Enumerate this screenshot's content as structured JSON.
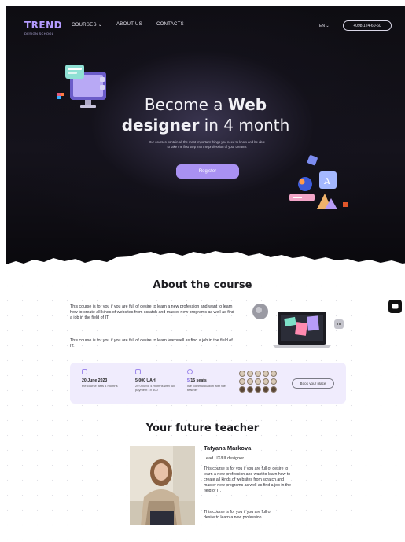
{
  "nav": {
    "logo": "TREND",
    "logo_sub": "DESIGN SCHOOL",
    "courses": "COURSES",
    "about": "ABOUT US",
    "contacts": "CONTACTS",
    "lang": "EN",
    "phone": "+098 124-60-60"
  },
  "hero": {
    "title_1_pre": "Become a ",
    "title_1_bold": "Web",
    "title_2_bold": "designer",
    "title_2_post": " in 4 month",
    "description": "Our courses contain all the most important things you need to know and be able to take the first step into the profession of your dreams",
    "register_label": "Register"
  },
  "about": {
    "title": "About the course",
    "paragraph_1": "This course is for you if you are full of desire to learn a new profession and want to learn how to create all kinds of websites from scratch and master new programs as well as find a job in the field of IT.",
    "paragraph_2": "This course is for you if you are full of desire to learn learnwell as find a job in the field of IT.",
    "info": {
      "date_head": "20 June 2023",
      "date_sub": "the course lasts 4 months",
      "price_head": "5 000 UAH",
      "price_sub": "20 000 for 4 months with full payment 19 500",
      "seats_highlight": "5",
      "seats_rest": "/15 seats",
      "seats_sub": "live communication with the teacher",
      "book_label": "Book your place"
    }
  },
  "teacher": {
    "title": "Your future teacher",
    "name": "Tatyana Markova",
    "role": "Lead UX/UI designer",
    "paragraph_1": "This course is for you if you are full of desire to learn a new profession and want to learn how to create all kinds of websites from scratch and master new programs as well as find a job in the field of IT.",
    "paragraph_2": "This course is for you if you are full of desire to learn a new profession."
  },
  "colors": {
    "accent": "#a991f2",
    "accent_light": "#f0ecfd",
    "hero_bg": "#0e0d12"
  },
  "icons": {
    "courses_dropdown": "chevron-down-icon",
    "lang_dropdown": "chevron-down-icon",
    "chat": "chat-icon",
    "calendar": "calendar-icon",
    "wallet": "wallet-icon",
    "user": "user-icon"
  }
}
